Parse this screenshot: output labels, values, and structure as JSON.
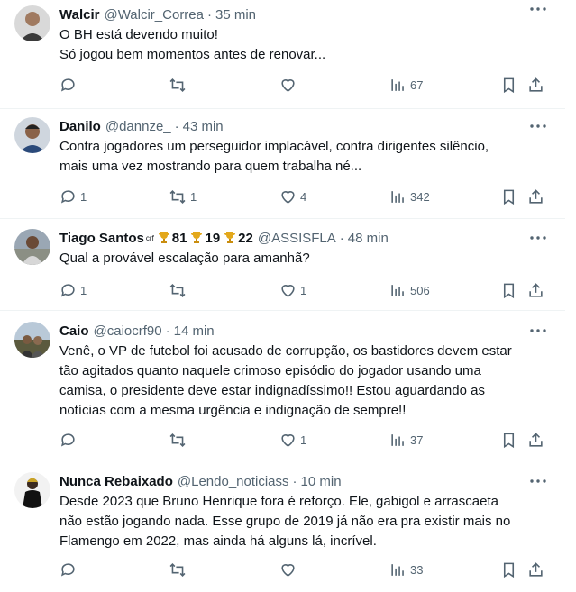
{
  "colors": {
    "text": "#0f1419",
    "secondary": "#536471",
    "divider": "#eff3f4"
  },
  "tweets": [
    {
      "name": "Walcir",
      "handle": "@Walcir_Correa",
      "time": "35 min",
      "lines": [
        "O BH está devendo muito!",
        "Só jogou bem momentos antes de renovar..."
      ],
      "replies": "",
      "retweets": "",
      "likes": "",
      "views": "67"
    },
    {
      "name": "Danilo",
      "handle": "@dannze_",
      "time": "43 min",
      "lines": [
        "Contra jogadores um perseguidor implacável, contra dirigentes silêncio,",
        "mais uma vez mostrando para quem trabalha né..."
      ],
      "replies": "1",
      "retweets": "1",
      "likes": "4",
      "views": "342"
    },
    {
      "name": "Tiago Santos",
      "badge": "crf",
      "trophies": [
        "81",
        "19",
        "22"
      ],
      "handle": "@ASSISFLA",
      "time": "48 min",
      "lines": [
        "Qual a provável escalação para amanhã?"
      ],
      "replies": "1",
      "retweets": "",
      "likes": "1",
      "views": "506"
    },
    {
      "name": "Caio",
      "handle": "@caiocrf90",
      "time": "14 min",
      "lines": [
        "Venê, o VP de futebol foi acusado de corrupção, os bastidores devem estar",
        "tão agitados quanto naquele crimoso episódio do jogador usando uma",
        "camisa,  o presidente deve estar indignadíssimo!! Estou aguardando as",
        "notícias com a mesma urgência e indignação de sempre!!"
      ],
      "replies": "",
      "retweets": "",
      "likes": "1",
      "views": "37"
    },
    {
      "name": "Nunca Rebaixado",
      "handle": "@Lendo_noticiass",
      "time": "10 min",
      "lines": [
        "Desde 2023 que Bruno Henrique fora é reforço. Ele, gabigol e arrascaeta",
        "não estão jogando nada. Esse grupo de 2019 já não era pra existir mais no",
        "Flamengo em 2022, mas ainda há alguns lá, incrível."
      ],
      "replies": "",
      "retweets": "",
      "likes": "",
      "views": "33"
    }
  ]
}
